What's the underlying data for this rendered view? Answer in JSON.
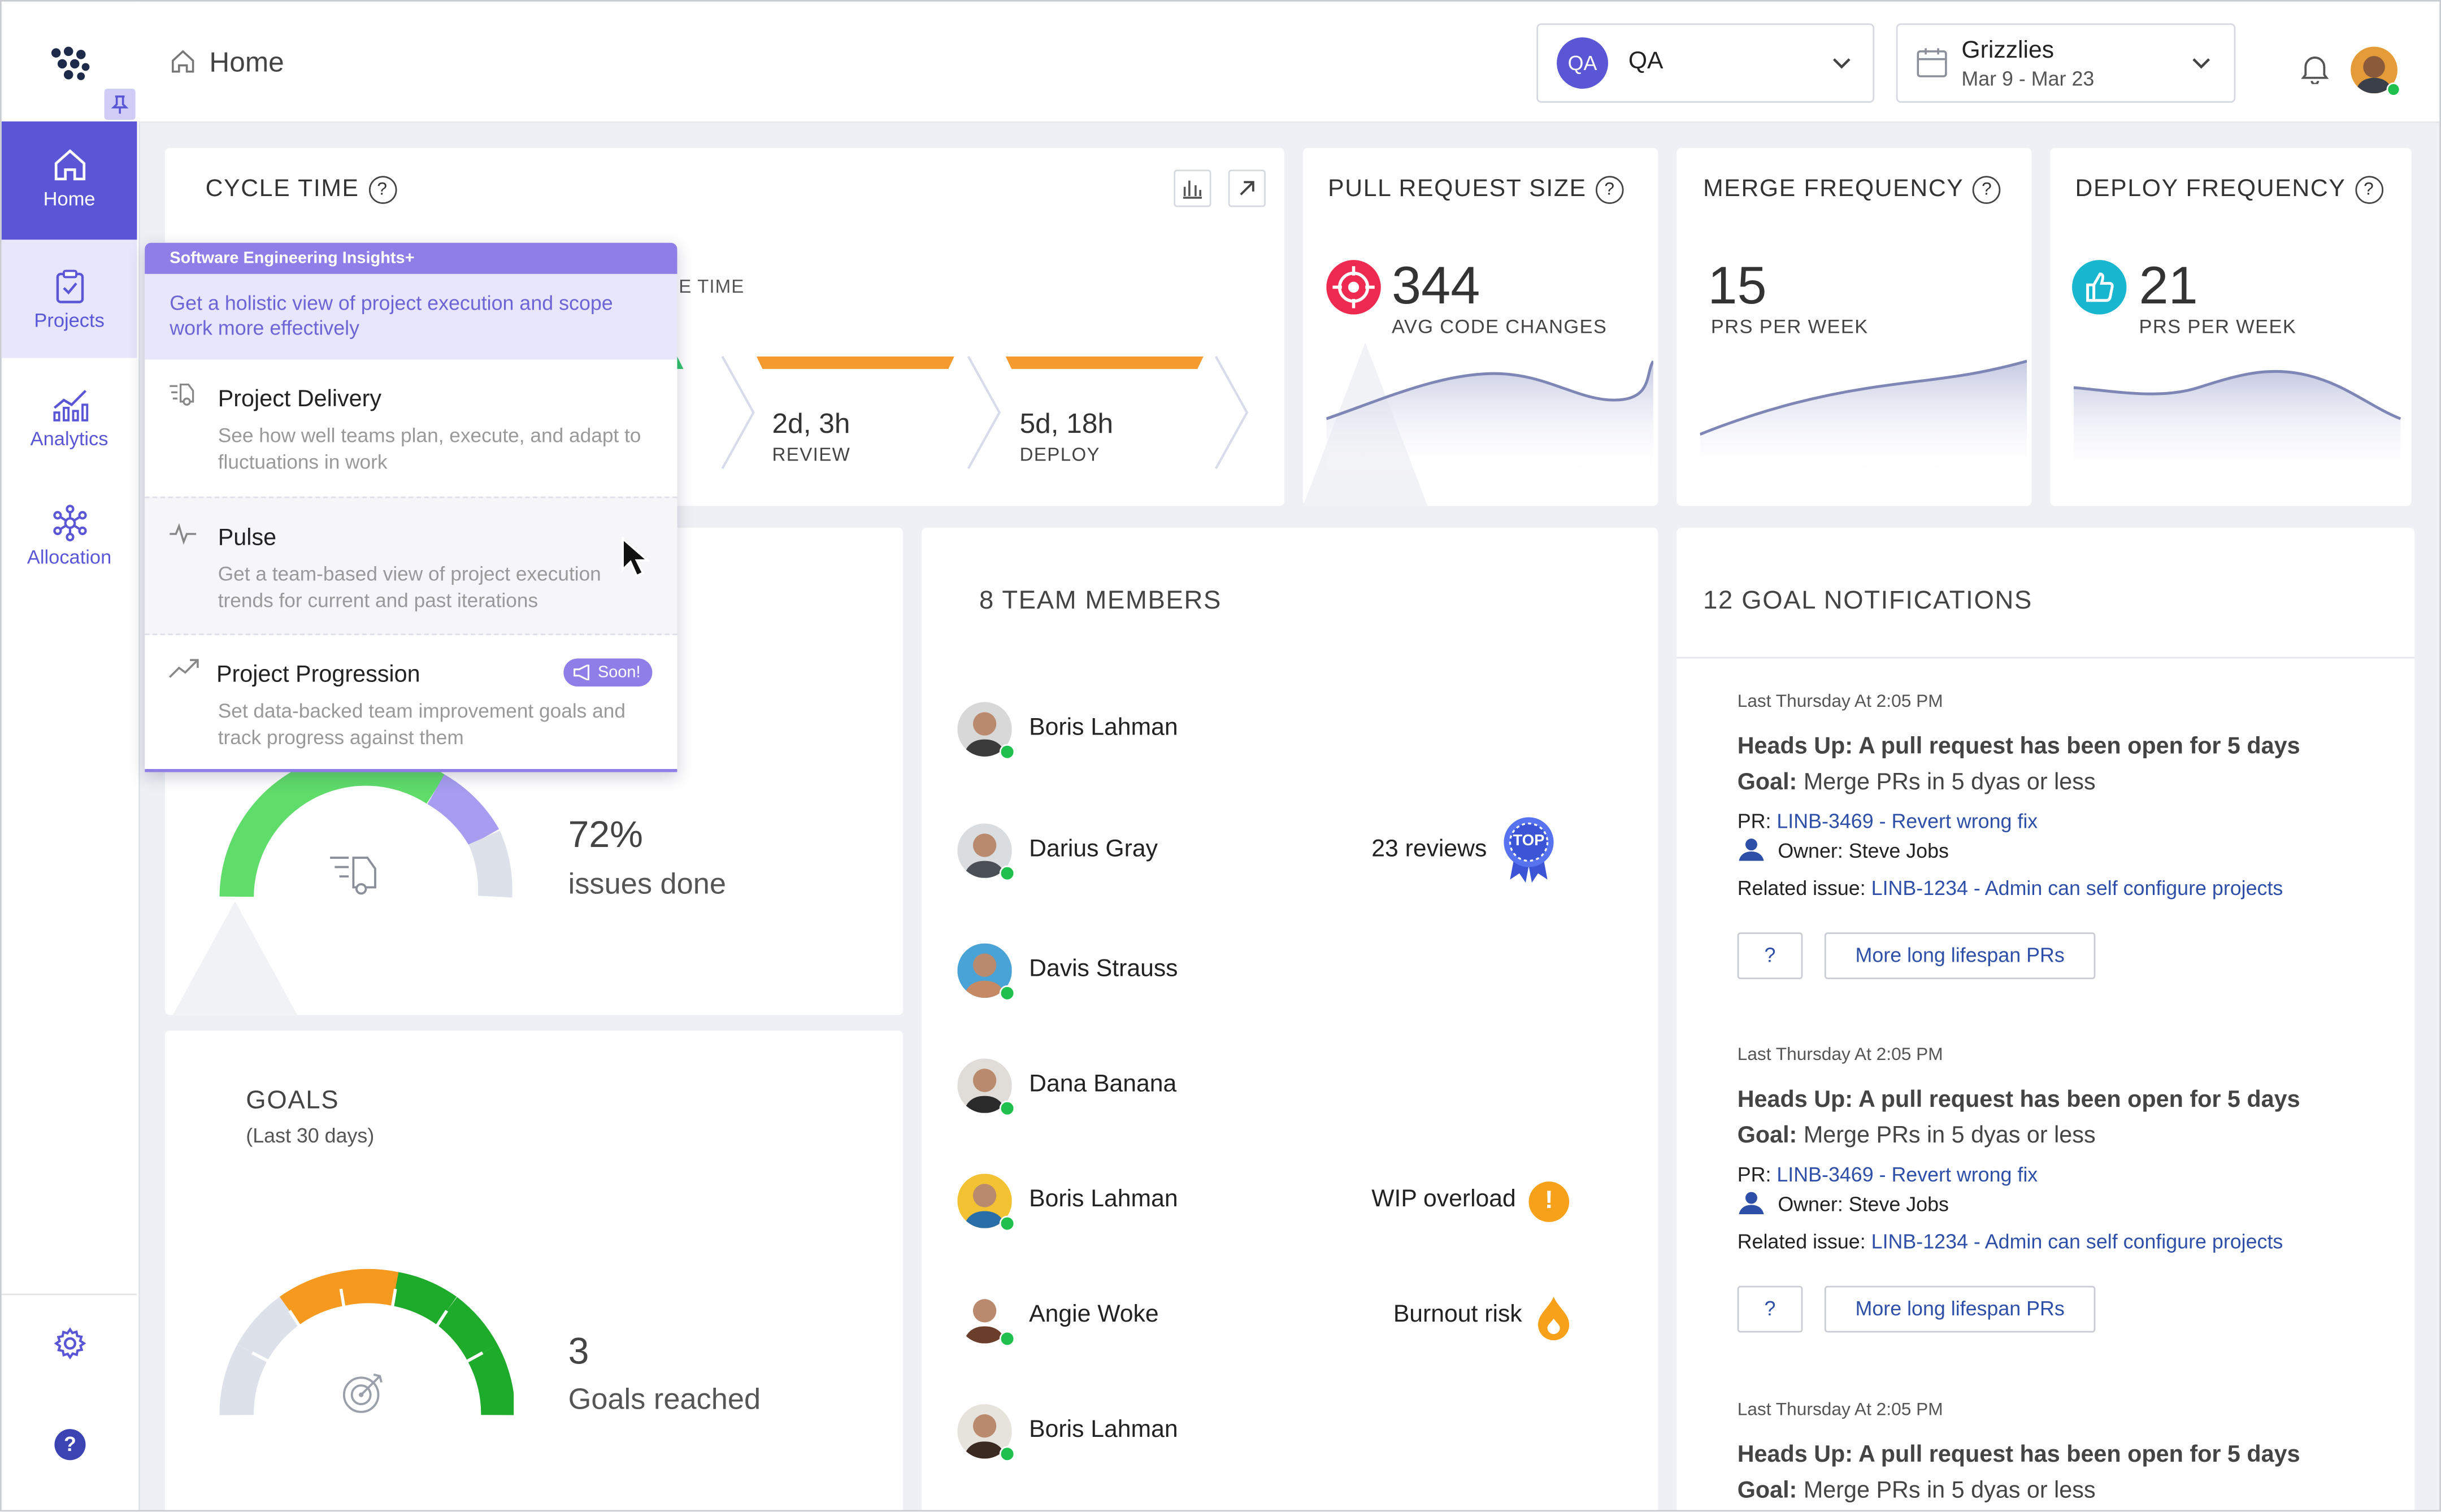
{
  "header": {
    "home_label": "Home"
  },
  "team_select": {
    "badge": "QA",
    "label": "QA"
  },
  "sprint_select": {
    "name": "Grizzlies",
    "dates": "Mar 9 - Mar 23"
  },
  "sidebar": {
    "items": [
      {
        "label": "Home"
      },
      {
        "label": "Projects"
      },
      {
        "label": "Analytics"
      },
      {
        "label": "Allocation"
      }
    ]
  },
  "cycle_time": {
    "title": "CYCLE TIME",
    "hidden_label_fragment": "E TIME",
    "stages": [
      {
        "value": "2d, 3h",
        "label": "REVIEW",
        "color": "#f59a2e"
      },
      {
        "value": "5d, 18h",
        "label": "DEPLOY",
        "color": "#f59a2e"
      }
    ]
  },
  "kpis": [
    {
      "title": "PULL REQUEST SIZE",
      "value": "344",
      "sub": "AVG CODE CHANGES",
      "icon": "target-icon",
      "color": "#ee2a50"
    },
    {
      "title": "MERGE FREQUENCY",
      "value": "15",
      "sub": "PRS PER WEEK"
    },
    {
      "title": "DEPLOY FREQUENCY",
      "value": "21",
      "sub": "PRS PER WEEK",
      "icon": "thumbs-up-icon",
      "color": "#18b6cf"
    }
  ],
  "issues": {
    "percent": "72%",
    "label": "issues done",
    "fraction_done": 0.72
  },
  "goals": {
    "title": "GOALS",
    "subtitle": "(Last 30 days)",
    "count": "3",
    "label": "Goals reached"
  },
  "team": {
    "title": "8 TEAM MEMBERS",
    "members": [
      {
        "name": "Boris Lahman",
        "status": "",
        "badge": ""
      },
      {
        "name": "Darius Gray",
        "status": "23 reviews",
        "badge": "TOP"
      },
      {
        "name": "Davis Strauss",
        "status": "",
        "badge": ""
      },
      {
        "name": "Dana Banana",
        "status": "",
        "badge": ""
      },
      {
        "name": "Boris Lahman",
        "status": "WIP overload",
        "badge": "!"
      },
      {
        "name": "Angie Woke",
        "status": "Burnout risk",
        "badge": ""
      },
      {
        "name": "Boris Lahman",
        "status": "",
        "badge": ""
      }
    ]
  },
  "notifications": {
    "title": "12 GOAL NOTIFICATIONS",
    "items": [
      {
        "time": "Last Thursday At 2:05 PM",
        "heading": "Heads Up: A pull request has been open for 5 days",
        "goal_label": "Goal:",
        "goal": "Merge PRs in 5 dyas or less",
        "pr_label": "PR:",
        "pr": "LINB-3469 - Revert wrong fix",
        "owner": "Owner: Steve Jobs",
        "issue_label": "Related issue:",
        "issue": "LINB-1234 - Admin can self configure projects",
        "btn_q": "?",
        "btn_more": "More long lifespan PRs"
      },
      {
        "time": "Last Thursday At 2:05 PM",
        "heading": "Heads Up: A pull request has been open for 5 days",
        "goal_label": "Goal:",
        "goal": "Merge PRs in 5 dyas or less",
        "pr_label": "PR:",
        "pr": "LINB-3469 - Revert wrong fix",
        "owner": "Owner: Steve Jobs",
        "issue_label": "Related issue:",
        "issue": "LINB-1234 - Admin can self configure projects",
        "btn_q": "?",
        "btn_more": "More long lifespan PRs"
      },
      {
        "time": "Last Thursday At 2:05 PM",
        "heading": "Heads Up: A pull request has been open for 5 days",
        "goal_label": "Goal:",
        "goal": "Merge PRs in 5 dyas or less"
      }
    ]
  },
  "dropdown": {
    "header": "Software Engineering Insights+",
    "intro": "Get a holistic view of project execution and scope work more effectively",
    "items": [
      {
        "title": "Project Delivery",
        "desc": "See how well teams plan, execute, and adapt to fluctuations in work"
      },
      {
        "title": "Pulse",
        "desc": "Get a team-based view of project execution trends for current and past iterations"
      },
      {
        "title": "Project Progression",
        "desc": "Set data-backed team improvement goals and track progress against them",
        "badge": "Soon!"
      }
    ]
  },
  "colors": {
    "accent": "#5a56d6",
    "nav_active": "#5a56d6",
    "online": "#1fc04d",
    "purple": "#8f7de8"
  }
}
